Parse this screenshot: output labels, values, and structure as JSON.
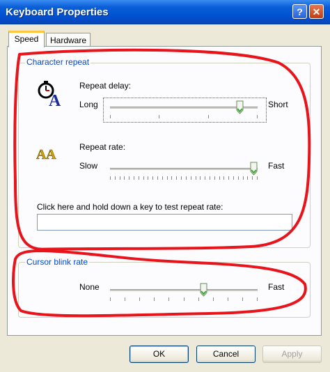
{
  "window": {
    "title": "Keyboard Properties",
    "help_glyph": "?",
    "close_glyph": "✕"
  },
  "tabs": [
    {
      "label": "Speed",
      "selected": true
    },
    {
      "label": "Hardware",
      "selected": false
    }
  ],
  "character_repeat": {
    "legend": "Character repeat",
    "repeat_delay": {
      "label": "Repeat delay:",
      "min_label": "Long",
      "max_label": "Short",
      "value": 0.9,
      "tick_count": 4
    },
    "repeat_rate": {
      "label": "Repeat rate:",
      "min_label": "Slow",
      "max_label": "Fast",
      "value": 1.0,
      "tick_count": 32
    },
    "test_label": "Click here and hold down a key to test repeat rate:",
    "test_value": ""
  },
  "cursor_blink": {
    "legend": "Cursor blink rate",
    "min_label": "None",
    "max_label": "Fast",
    "value": 0.64,
    "tick_count": 11
  },
  "buttons": {
    "ok": "OK",
    "cancel": "Cancel",
    "apply": "Apply"
  },
  "annotation_color": "#e8141c"
}
